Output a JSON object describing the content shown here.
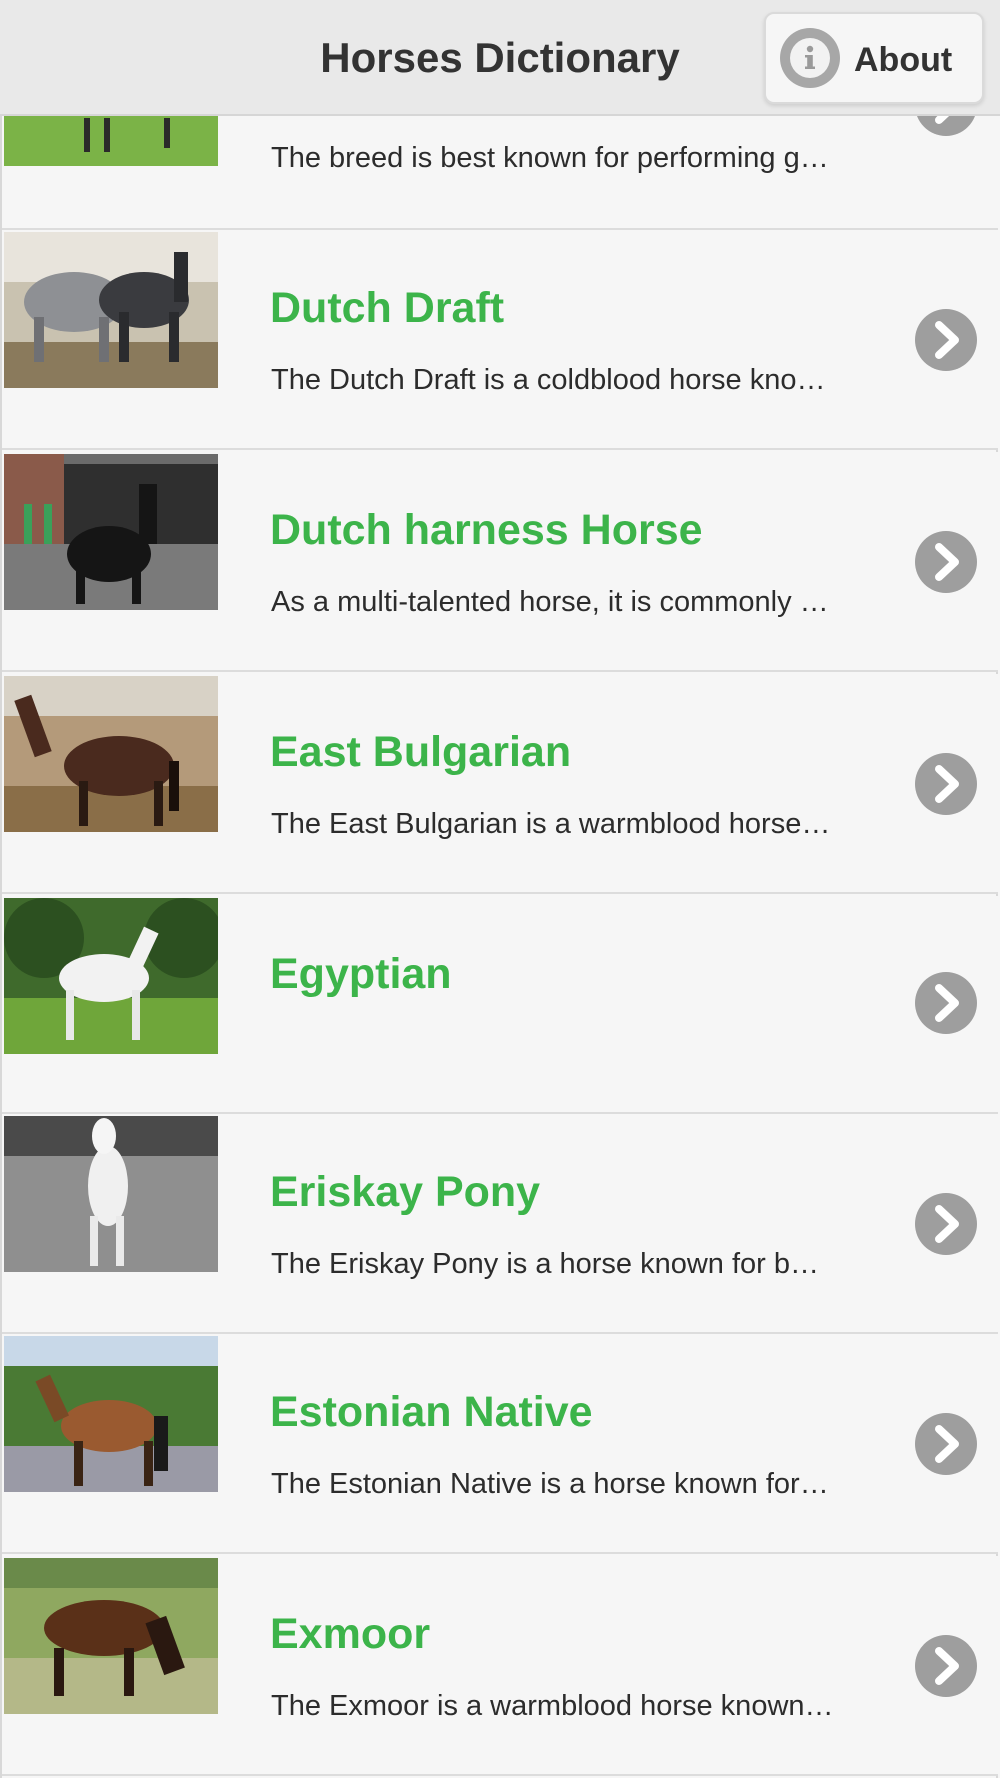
{
  "header": {
    "title": "Horses Dictionary",
    "about_label": "About"
  },
  "colors": {
    "accent": "#3cb44a",
    "chevron": "#9e9e9e"
  },
  "items": [
    {
      "title": "",
      "description": "The breed is best known for performing g…",
      "thumbnail": "horse-photo"
    },
    {
      "title": "Dutch Draft",
      "description": "The Dutch Draft is a coldblood horse kno…",
      "thumbnail": "horse-photo"
    },
    {
      "title": "Dutch harness Horse",
      "description": "As a multi-talented horse, it is commonly …",
      "thumbnail": "horse-photo"
    },
    {
      "title": "East Bulgarian",
      "description": "The East Bulgarian is a warmblood horse…",
      "thumbnail": "horse-photo"
    },
    {
      "title": "Egyptian",
      "description": "",
      "thumbnail": "horse-photo"
    },
    {
      "title": "Eriskay Pony",
      "description": "The Eriskay Pony is a horse known for b…",
      "thumbnail": "horse-photo"
    },
    {
      "title": "Estonian Native",
      "description": "The Estonian Native is a horse known for…",
      "thumbnail": "horse-photo"
    },
    {
      "title": "Exmoor",
      "description": "The Exmoor is a warmblood horse known…",
      "thumbnail": "horse-photo"
    }
  ]
}
